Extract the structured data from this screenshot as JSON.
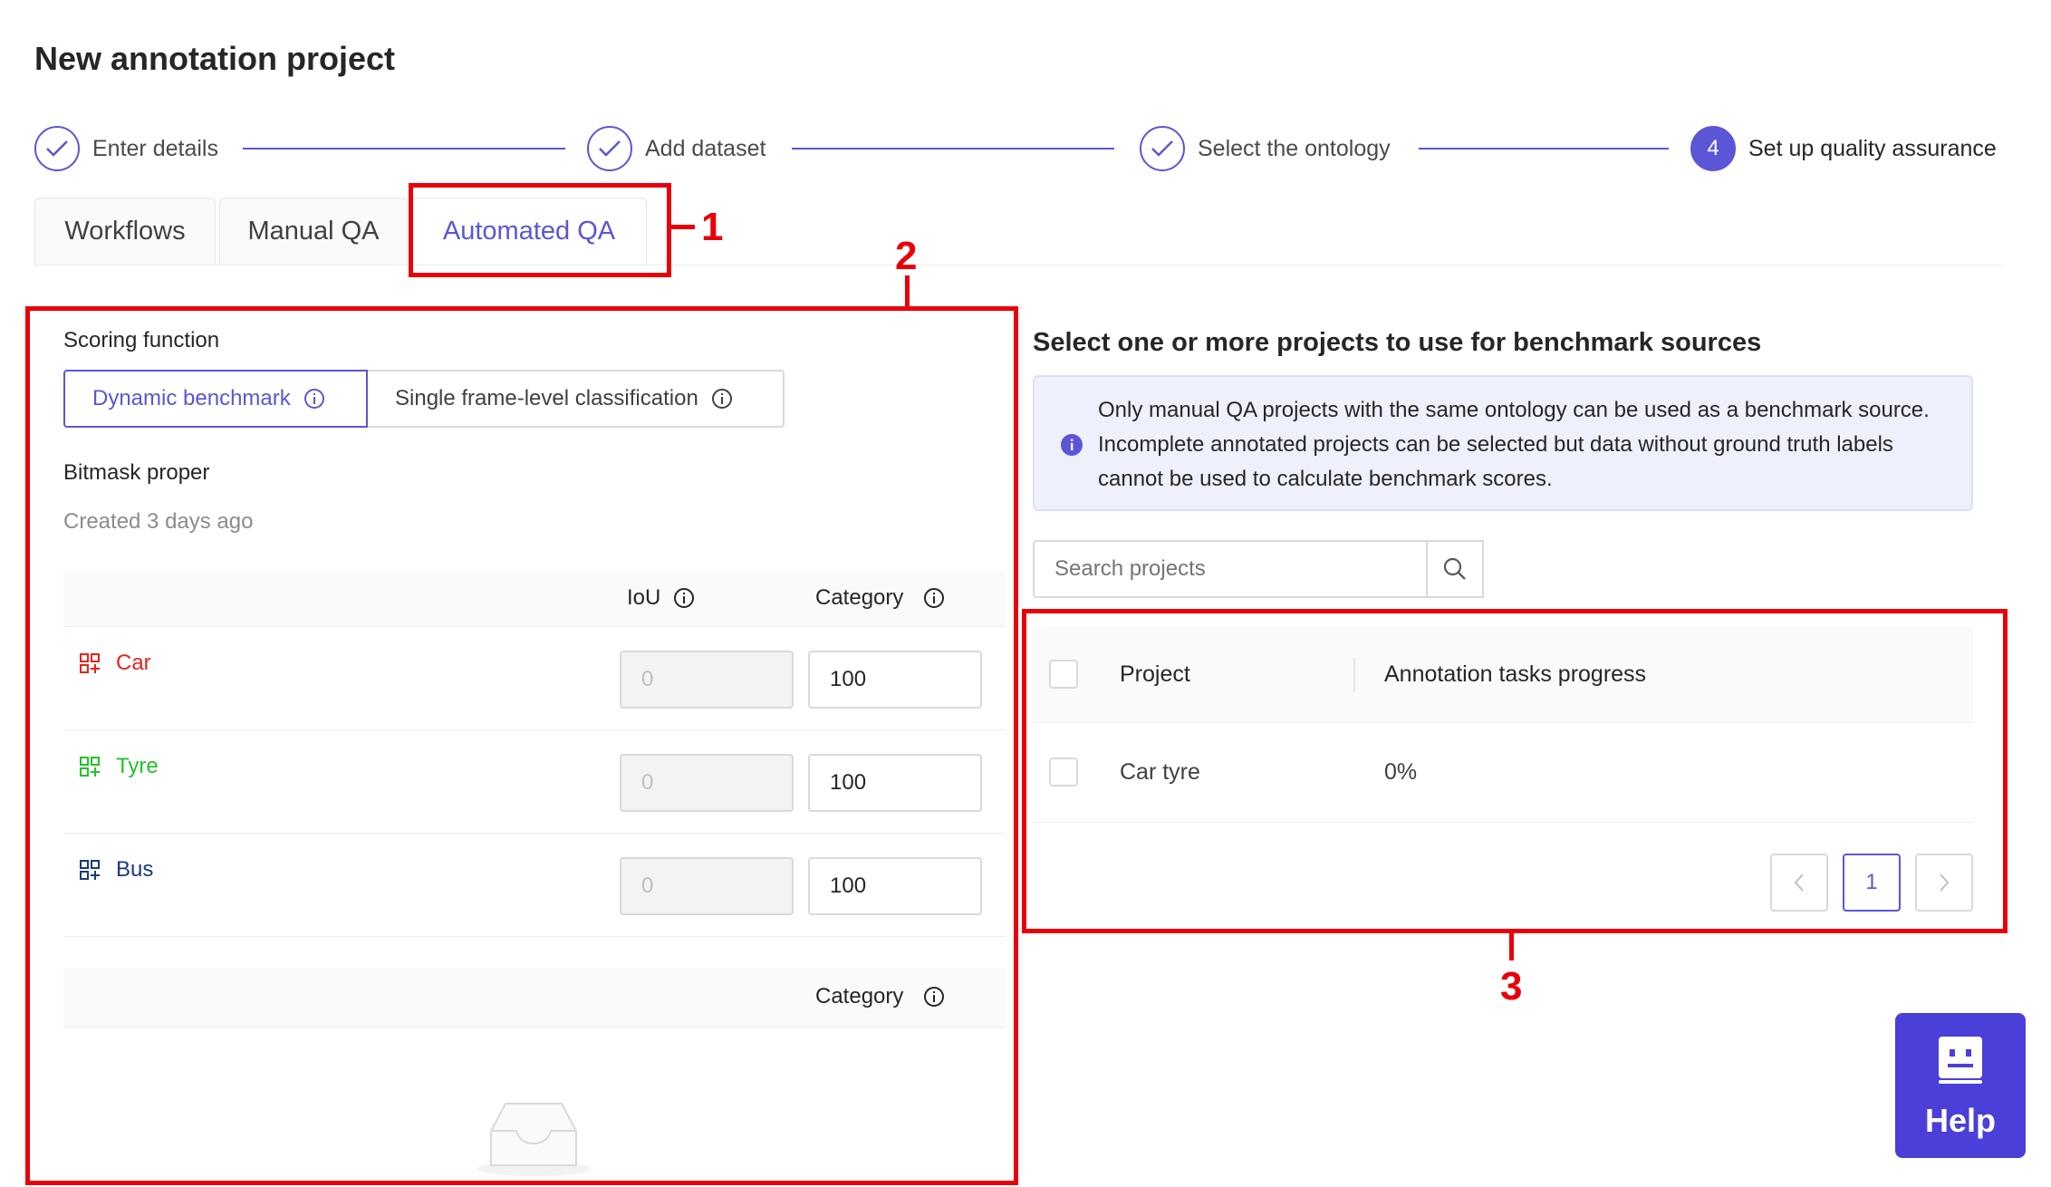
{
  "page": {
    "title": "New annotation project"
  },
  "stepper": {
    "steps": [
      {
        "label": "Enter details",
        "status": "done"
      },
      {
        "label": "Add dataset",
        "status": "done"
      },
      {
        "label": "Select the ontology",
        "status": "done"
      },
      {
        "label": "Set up quality assurance",
        "status": "active",
        "number": "4"
      }
    ],
    "accent_color": "#5b56d6"
  },
  "tabs": [
    {
      "label": "Workflows"
    },
    {
      "label": "Manual QA"
    },
    {
      "label": "Automated QA",
      "active": true
    }
  ],
  "annotations": {
    "box1": "1",
    "box2": "2",
    "box3": "3",
    "color": "#e8000b"
  },
  "scoring": {
    "label": "Scoring function",
    "options": [
      {
        "label": "Dynamic benchmark",
        "selected": true
      },
      {
        "label": "Single frame-level classification",
        "selected": false
      }
    ]
  },
  "ontology": {
    "name": "Bitmask proper",
    "created": "Created 3 days ago"
  },
  "objects_table": {
    "headers": {
      "iou": "IoU",
      "category": "Category"
    },
    "rows": [
      {
        "name": "Car",
        "color": "#e8231c",
        "iou": "0",
        "category": "100"
      },
      {
        "name": "Tyre",
        "color": "#21c32a",
        "iou": "0",
        "category": "100"
      },
      {
        "name": "Bus",
        "color": "#1a3a7a",
        "iou": "0",
        "category": "100"
      }
    ]
  },
  "classifications_table": {
    "headers": {
      "category": "Category"
    }
  },
  "benchmark": {
    "title": "Select one or more projects to use for benchmark sources",
    "info": "Only manual QA projects with the same ontology can be used as a benchmark source. Incomplete annotated projects can be selected but data without ground truth labels cannot be used to calculate benchmark scores.",
    "search_placeholder": "Search projects",
    "table": {
      "headers": {
        "project": "Project",
        "progress": "Annotation tasks progress"
      },
      "rows": [
        {
          "project": "Car tyre",
          "progress": "0%"
        }
      ]
    },
    "pagination": {
      "current": "1"
    }
  },
  "help": {
    "label": "Help"
  }
}
